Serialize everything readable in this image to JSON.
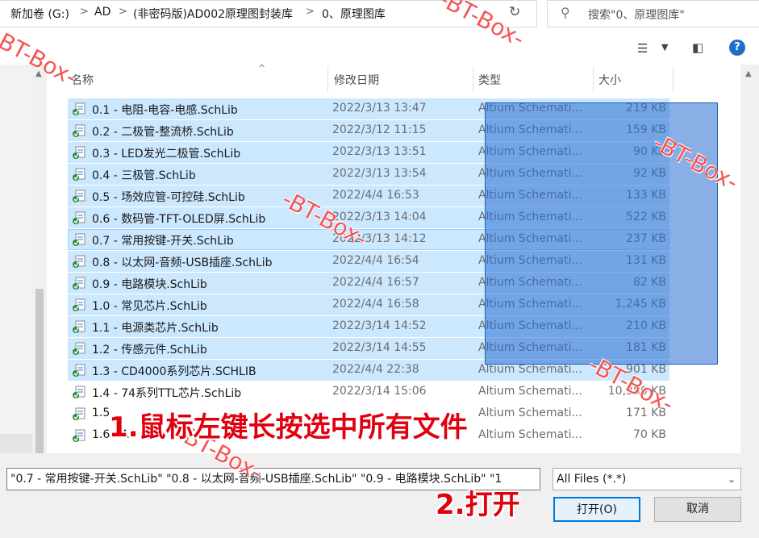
{
  "address": {
    "crumbs": [
      "新加卷 (G:)",
      "AD",
      "(非密码版)AD002原理图封装库",
      "0、原理图库"
    ],
    "separator": ">",
    "refresh_glyph": "↻"
  },
  "search": {
    "placeholder": "搜索\"0、原理图库\"",
    "icon": "search-icon"
  },
  "toolbar": {
    "view_icon": "view-options-icon",
    "pane_icon": "preview-pane-icon",
    "help_label": "?"
  },
  "columns": {
    "name": "名称",
    "date": "修改日期",
    "type": "类型",
    "size": "大小"
  },
  "files": [
    {
      "name": "0.1 - 电阻-电容-电感.SchLib",
      "date": "2022/3/13 13:47",
      "type": "Altium Schemati...",
      "size": "219 KB",
      "selected": true
    },
    {
      "name": "0.2 - 二极管-整流桥.SchLib",
      "date": "2022/3/12 11:15",
      "type": "Altium Schemati...",
      "size": "159 KB",
      "selected": true
    },
    {
      "name": "0.3 - LED发光二极管.SchLib",
      "date": "2022/3/13 13:51",
      "type": "Altium Schemati...",
      "size": "90 KB",
      "selected": true
    },
    {
      "name": "0.4 - 三极管.SchLib",
      "date": "2022/3/13 13:54",
      "type": "Altium Schemati...",
      "size": "92 KB",
      "selected": true
    },
    {
      "name": "0.5 - 场效应管-可控硅.SchLib",
      "date": "2022/4/4 16:53",
      "type": "Altium Schemati...",
      "size": "133 KB",
      "selected": true
    },
    {
      "name": "0.6 - 数码管-TFT-OLED屏.SchLib",
      "date": "2022/3/13 14:04",
      "type": "Altium Schemati...",
      "size": "522 KB",
      "selected": true
    },
    {
      "name": "0.7 - 常用按键-开关.SchLib",
      "date": "2022/3/13 14:12",
      "type": "Altium Schemati...",
      "size": "237 KB",
      "selected": true
    },
    {
      "name": "0.8 - 以太网-音频-USB插座.SchLib",
      "date": "2022/4/4 16:54",
      "type": "Altium Schemati...",
      "size": "131 KB",
      "selected": true
    },
    {
      "name": "0.9 - 电路模块.SchLib",
      "date": "2022/4/4 16:57",
      "type": "Altium Schemati...",
      "size": "82 KB",
      "selected": true
    },
    {
      "name": "1.0 - 常见芯片.SchLib",
      "date": "2022/4/4 16:58",
      "type": "Altium Schemati...",
      "size": "1,245 KB",
      "selected": true
    },
    {
      "name": "1.1 - 电源类芯片.SchLib",
      "date": "2022/3/14 14:52",
      "type": "Altium Schemati...",
      "size": "210 KB",
      "selected": true
    },
    {
      "name": "1.2 - 传感元件.SchLib",
      "date": "2022/3/14 14:55",
      "type": "Altium Schemati...",
      "size": "181 KB",
      "selected": true
    },
    {
      "name": "1.3 - CD4000系列芯片.SCHLIB",
      "date": "2022/4/4 22:38",
      "type": "Altium Schemati...",
      "size": "901 KB",
      "selected": true
    },
    {
      "name": "1.4 - 74系列TTL芯片.SchLib",
      "date": "2022/3/14 15:06",
      "type": "Altium Schemati...",
      "size": "10,380 KB",
      "selected": false
    },
    {
      "name": "1.5",
      "date": "",
      "type": "Altium Schemati...",
      "size": "171 KB",
      "selected": false
    },
    {
      "name": "1.6 - AD",
      "date": "",
      "type": "Altium Schemati...",
      "size": "70 KB",
      "selected": false
    }
  ],
  "filename": {
    "value": "\"0.7 - 常用按键-开关.SchLib\" \"0.8 - 以太网-音频-USB插座.SchLib\" \"0.9 - 电路模块.SchLib\" \"1"
  },
  "filetype": {
    "value": "All Files (*.*)"
  },
  "buttons": {
    "open": "打开(O)",
    "cancel": "取消"
  },
  "annotations": {
    "step1": "1.鼠标左键长按选中所有文件",
    "step2": "2.打开"
  },
  "watermark": "-BT-Box-",
  "colors": {
    "selection": "#cce8ff",
    "marquee": "#286ed2",
    "annotation": "#e0000f",
    "primary_button": "#0078d7"
  }
}
